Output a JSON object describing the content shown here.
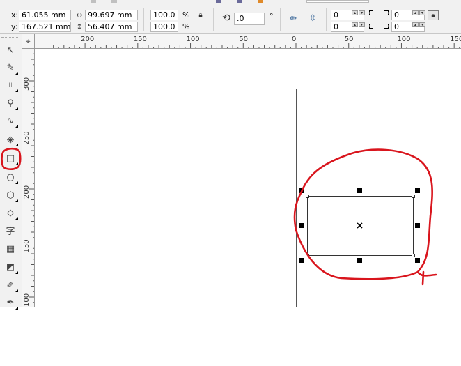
{
  "property_bar": {
    "x_label": "x:",
    "x_value": "61.055 mm",
    "y_label": "y:",
    "y_value": "167.521 mm",
    "width_value": "99.697 mm",
    "height_value": "56.407 mm",
    "scale_x_value": "100.0",
    "scale_y_value": "100.0",
    "percent_symbol": "%",
    "rotation_value": ".0",
    "degree_symbol": "°",
    "corner_top_left": "0",
    "corner_bottom_left": "0",
    "corner_top_right": "0",
    "corner_bottom_right": "0"
  },
  "rulers": {
    "horizontal_ticks": [
      {
        "value": 200,
        "label": "200"
      },
      {
        "value": 150,
        "label": "150"
      },
      {
        "value": 100,
        "label": "100"
      },
      {
        "value": 50,
        "label": "50"
      },
      {
        "value": 0,
        "label": "0"
      },
      {
        "value": -50,
        "label": "50"
      },
      {
        "value": -100,
        "label": "100"
      },
      {
        "value": -150,
        "label": "150"
      }
    ],
    "vertical_ticks": [
      {
        "value": 300,
        "label": "300"
      },
      {
        "value": 250,
        "label": "250"
      },
      {
        "value": 200,
        "label": "200"
      },
      {
        "value": 150,
        "label": "150"
      },
      {
        "value": 100,
        "label": "100"
      }
    ]
  },
  "toolbox": {
    "tools": [
      {
        "name": "pick-tool",
        "glyph": "↖",
        "flyout": false
      },
      {
        "name": "shape-tool",
        "glyph": "✎",
        "flyout": true
      },
      {
        "name": "crop-tool",
        "glyph": "⌗",
        "flyout": true
      },
      {
        "name": "zoom-tool",
        "glyph": "⚲",
        "flyout": true
      },
      {
        "name": "freehand-tool",
        "glyph": "∿",
        "flyout": true
      },
      {
        "name": "smart-fill-tool",
        "glyph": "◈",
        "flyout": true
      },
      {
        "name": "rectangle-tool",
        "glyph": "□",
        "flyout": true,
        "active": true
      },
      {
        "name": "ellipse-tool",
        "glyph": "○",
        "flyout": true
      },
      {
        "name": "polygon-tool",
        "glyph": "⬡",
        "flyout": true
      },
      {
        "name": "basic-shapes-tool",
        "glyph": "◇",
        "flyout": true
      },
      {
        "name": "text-tool",
        "glyph": "字",
        "flyout": false
      },
      {
        "name": "table-tool",
        "glyph": "▦",
        "flyout": false
      },
      {
        "name": "interactive-tool",
        "glyph": "◩",
        "flyout": true
      },
      {
        "name": "eyedropper-tool",
        "glyph": "✐",
        "flyout": true
      },
      {
        "name": "outline-pen-tool",
        "glyph": "✒",
        "flyout": true
      }
    ]
  },
  "colors": {
    "annotation_red": "#d9151d",
    "toolbar_bg": "#f1f1f1",
    "ruler_bg": "#f5f5f5"
  }
}
